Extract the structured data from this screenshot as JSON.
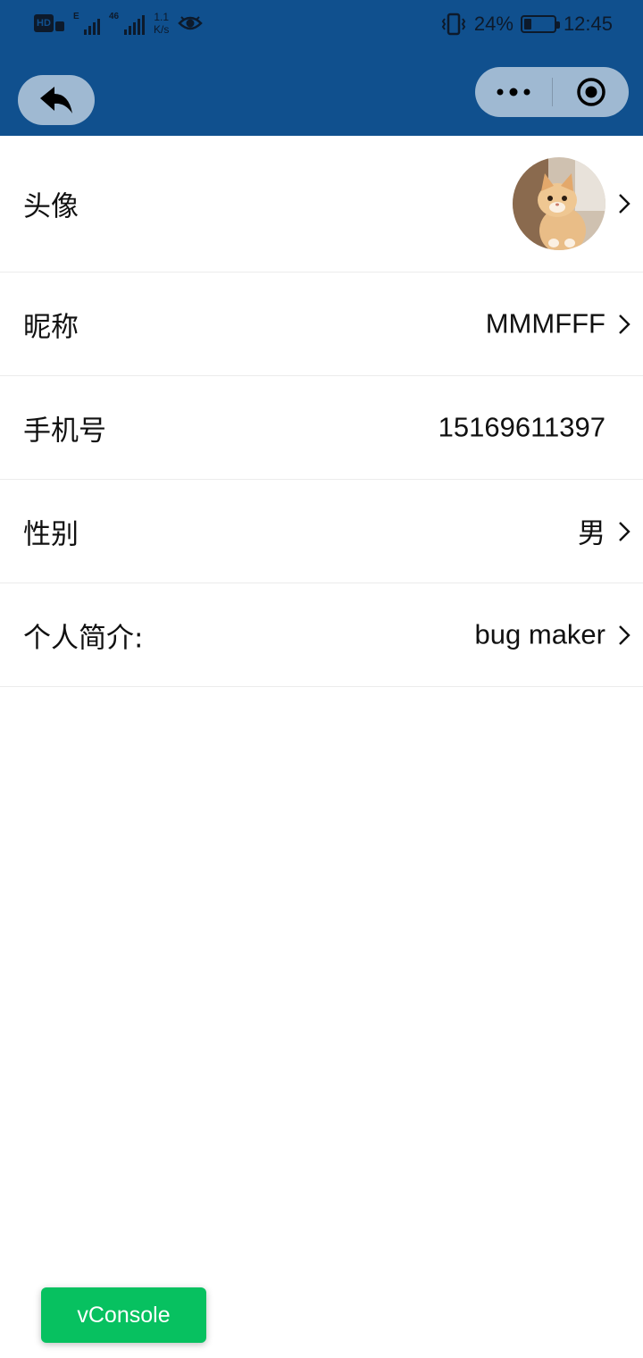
{
  "status_bar": {
    "hd_label": "HD",
    "sim1_tag": "E",
    "sim2_tag": "46",
    "net_speed_value": "1.1",
    "net_speed_unit": "K/s",
    "battery_percent": "24%",
    "battery_level": 0.24,
    "time": "12:45",
    "icons": [
      "hd-icon",
      "signal-icon",
      "eye-icon",
      "vibrate-icon",
      "battery-icon"
    ]
  },
  "nav": {
    "back_icon": "back-arrow-icon",
    "more_icon": "more-dots-icon",
    "close_icon": "target-circle-icon",
    "capsule_color": "#a7bfd9"
  },
  "profile": {
    "avatar": {
      "label": "头像"
    },
    "nickname": {
      "label": "昵称",
      "value": "MMMFFF"
    },
    "phone": {
      "label": "手机号",
      "value": "15169611397"
    },
    "gender": {
      "label": "性别",
      "value": "男"
    },
    "bio": {
      "label": "个人简介:",
      "value": "bug maker"
    }
  },
  "vconsole": {
    "label": "vConsole",
    "color": "#07c160"
  },
  "colors": {
    "header": "#10508e",
    "divider": "#ececec"
  }
}
